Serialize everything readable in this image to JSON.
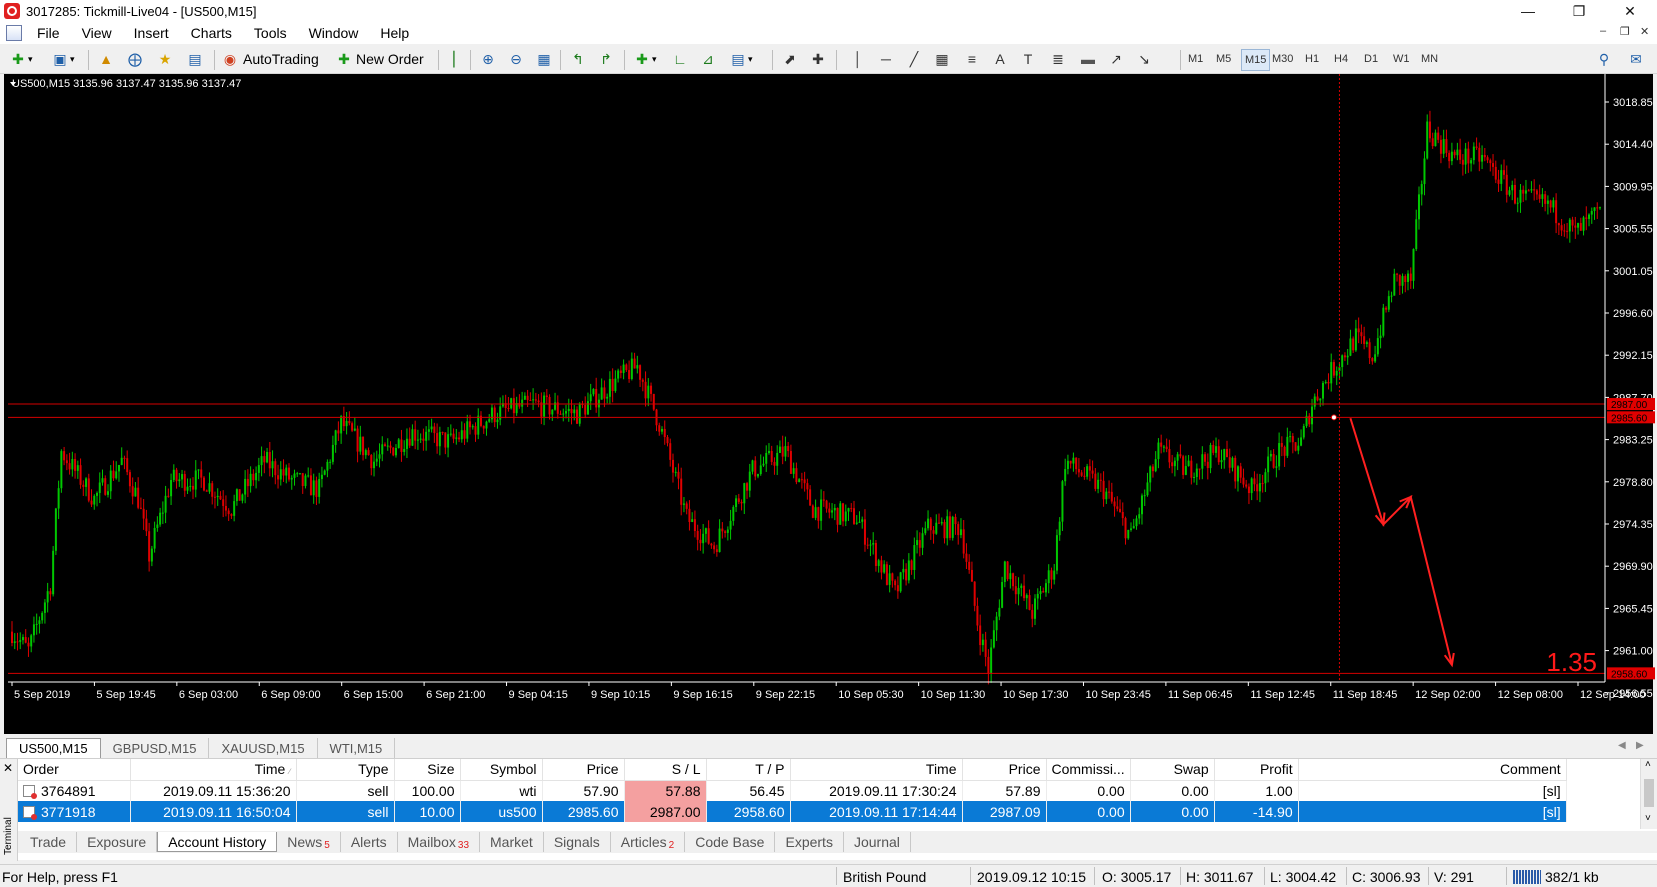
{
  "window": {
    "title": "3017285: Tickmill-Live04 - [US500,M15]"
  },
  "menu": [
    "File",
    "View",
    "Insert",
    "Charts",
    "Tools",
    "Window",
    "Help"
  ],
  "toolbar": {
    "autotrading_label": "AutoTrading",
    "new_order_label": "New Order",
    "timeframes": [
      "M1",
      "M5",
      "M15",
      "M30",
      "H1",
      "H4",
      "D1",
      "W1",
      "MN"
    ],
    "active_timeframe": "M15"
  },
  "chart": {
    "header": "US500,M15  3135.96 3137.47 3135.96 3137.47",
    "price_labels": [
      "3018.85",
      "3014.40",
      "3009.95",
      "3005.55",
      "3001.05",
      "2996.60",
      "2992.15",
      "2987.70",
      "2983.25",
      "2978.80",
      "2974.35",
      "2969.90",
      "2965.45",
      "2961.00",
      "2956.55"
    ],
    "time_labels": [
      "5 Sep 2019",
      "5 Sep 19:45",
      "6 Sep 03:00",
      "6 Sep 09:00",
      "6 Sep 15:00",
      "6 Sep 21:00",
      "9 Sep 04:15",
      "9 Sep 10:15",
      "9 Sep 16:15",
      "9 Sep 22:15",
      "10 Sep 05:30",
      "10 Sep 11:30",
      "10 Sep 17:30",
      "10 Sep 23:45",
      "11 Sep 06:45",
      "11 Sep 12:45",
      "11 Sep 18:45",
      "12 Sep 02:00",
      "12 Sep 08:00",
      "12 Sep 14:00"
    ],
    "level_tags": [
      "2987.00",
      "2985.60",
      "2958.60"
    ],
    "big_value": "1.35",
    "colors": {
      "bull": "#00c800",
      "bear": "#e00000",
      "grid_line": "#d40000",
      "bg": "#000000"
    }
  },
  "chart_tabs": [
    "US500,M15",
    "GBPUSD,M15",
    "XAUUSD,M15",
    "WTI,M15"
  ],
  "active_chart_tab": "US500,M15",
  "terminal": {
    "side_label": "Terminal",
    "columns": [
      "Order",
      "Time",
      "Type",
      "Size",
      "Symbol",
      "Price",
      "S / L",
      "T / P",
      "Time",
      "Price",
      "Commissi...",
      "Swap",
      "Profit",
      "Comment"
    ],
    "rows": [
      [
        "3764891",
        "2019.09.11 15:36:20",
        "sell",
        "100.00",
        "wti",
        "57.90",
        "57.88",
        "56.45",
        "2019.09.11 17:30:24",
        "57.89",
        "0.00",
        "0.00",
        "1.00",
        "[sl]"
      ],
      [
        "3771918",
        "2019.09.11 16:50:04",
        "sell",
        "10.00",
        "us500",
        "2985.60",
        "2987.00",
        "2958.60",
        "2019.09.11 17:14:44",
        "2987.09",
        "0.00",
        "0.00",
        "-14.90",
        "[sl]"
      ]
    ],
    "selected_row": 1,
    "tabs": [
      {
        "label": "Trade",
        "badge": ""
      },
      {
        "label": "Exposure",
        "badge": ""
      },
      {
        "label": "Account History",
        "badge": ""
      },
      {
        "label": "News",
        "badge": "5"
      },
      {
        "label": "Alerts",
        "badge": ""
      },
      {
        "label": "Mailbox",
        "badge": "33"
      },
      {
        "label": "Market",
        "badge": ""
      },
      {
        "label": "Signals",
        "badge": ""
      },
      {
        "label": "Articles",
        "badge": "2"
      },
      {
        "label": "Code Base",
        "badge": ""
      },
      {
        "label": "Experts",
        "badge": ""
      },
      {
        "label": "Journal",
        "badge": ""
      }
    ],
    "active_tab": "Account History"
  },
  "status": {
    "help": "For Help, press F1",
    "profile": "British Pound",
    "datetime": "2019.09.12 10:15",
    "open": "O: 3005.17",
    "high": "H: 3011.67",
    "low": "L: 3004.42",
    "close": "C: 3006.93",
    "volume": "V: 291",
    "traffic": "382/1 kb"
  }
}
